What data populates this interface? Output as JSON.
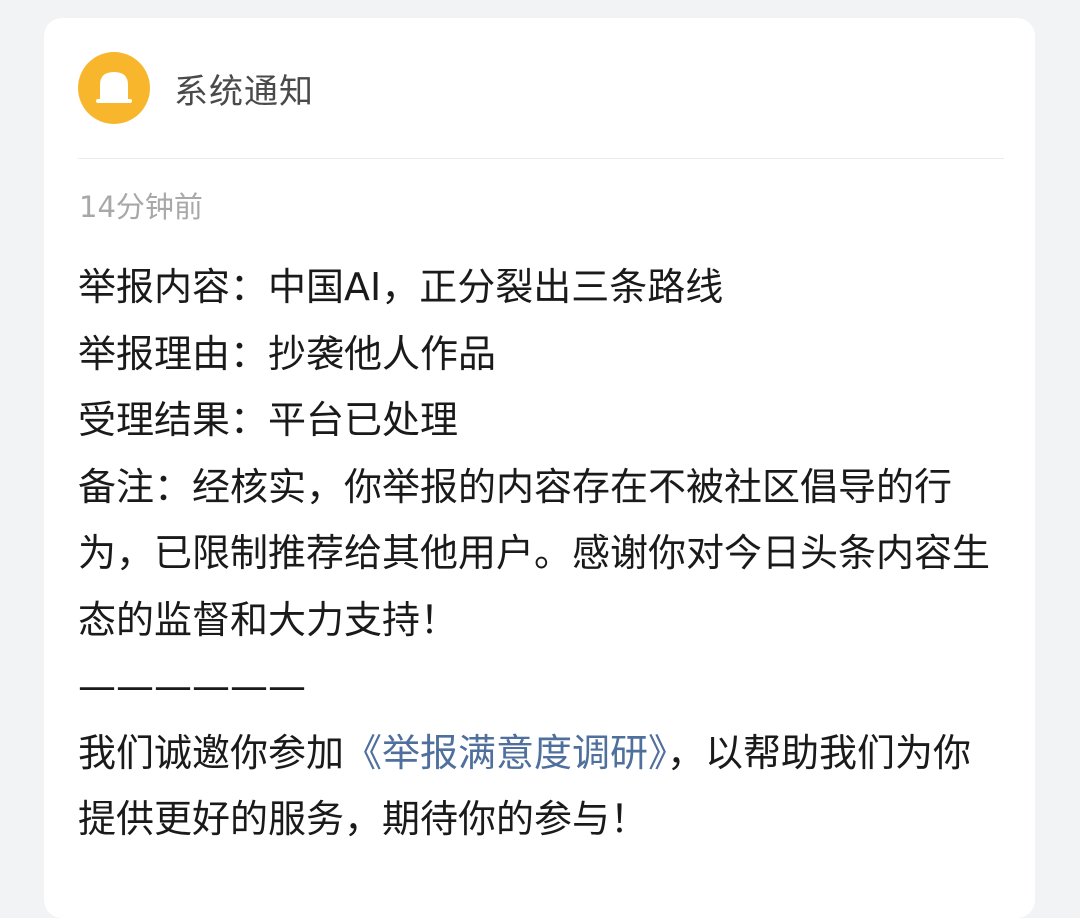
{
  "header": {
    "title": "系统通知",
    "icon": "bell-icon",
    "icon_bg_color": "#f7b62c"
  },
  "notification": {
    "time": "14分钟前",
    "report_content": "举报内容：中国AI，正分裂出三条路线",
    "report_reason": "举报理由：抄袭他人作品",
    "result": "受理结果：平台已处理",
    "note": "备注：经核实，你举报的内容存在不被社区倡导的行为，已限制推荐给其他用户。感谢你对今日头条内容生态的监督和大力支持！",
    "separator": "——————",
    "invite_prefix": "我们诚邀你参加",
    "survey_link": "《举报满意度调研》",
    "invite_suffix": "，以帮助我们为你提供更好的服务，期待你的参与！",
    "link_color": "#4f6f9c"
  }
}
